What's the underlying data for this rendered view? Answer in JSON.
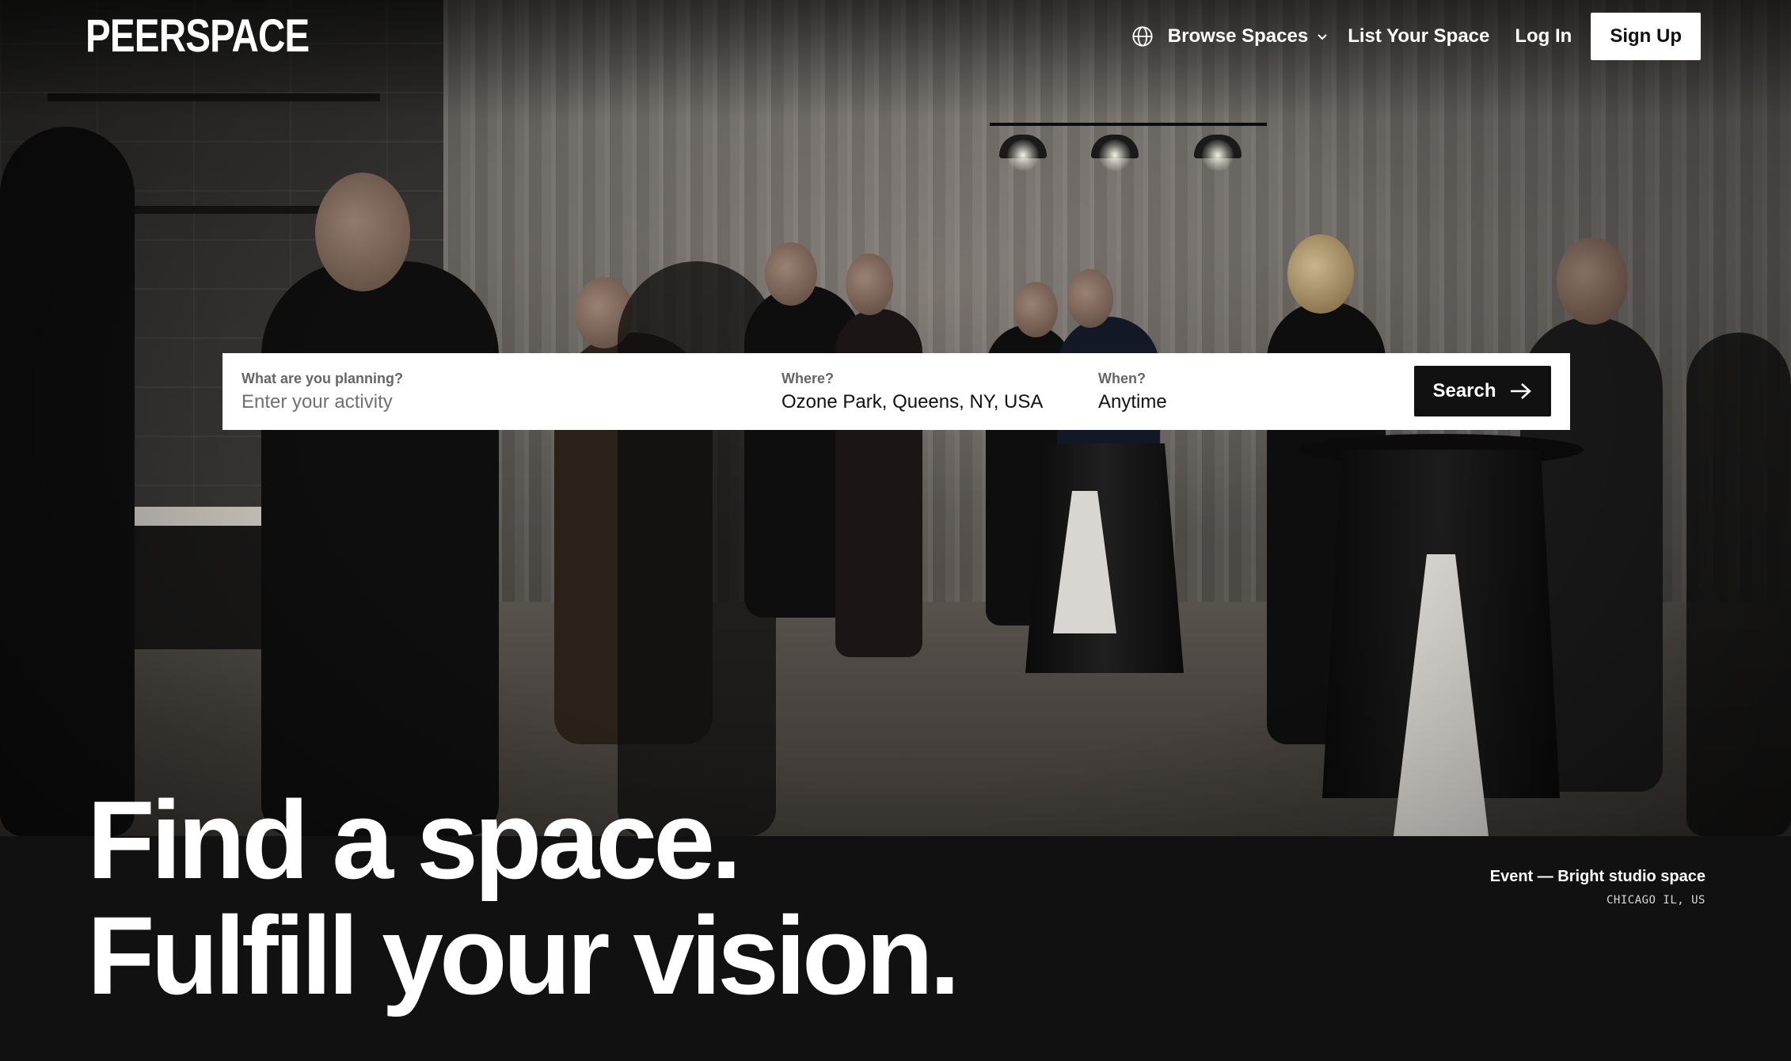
{
  "brand": {
    "logo_text": "PEERSPACE"
  },
  "nav": {
    "globe_icon": "globe-icon",
    "browse_label": "Browse Spaces",
    "browse_icon": "chevron-down-icon",
    "list_label": "List Your Space",
    "login_label": "Log In",
    "signup_label": "Sign Up"
  },
  "search": {
    "activity": {
      "label": "What are you planning?",
      "placeholder": "Enter your activity",
      "value": ""
    },
    "where": {
      "label": "Where?",
      "value": "Ozone Park, Queens, NY, USA"
    },
    "when": {
      "label": "When?",
      "value": "Anytime"
    },
    "button_label": "Search",
    "button_icon": "arrow-right-icon"
  },
  "hero": {
    "headline_line1": "Find a space.",
    "headline_line2": "Fulfill your vision.",
    "caption_title": "Event — Bright studio space",
    "caption_location": "CHICAGO IL, US"
  },
  "colors": {
    "background": "#111111",
    "text": "#ffffff",
    "button_dark": "#111111",
    "button_light": "#ffffff"
  }
}
